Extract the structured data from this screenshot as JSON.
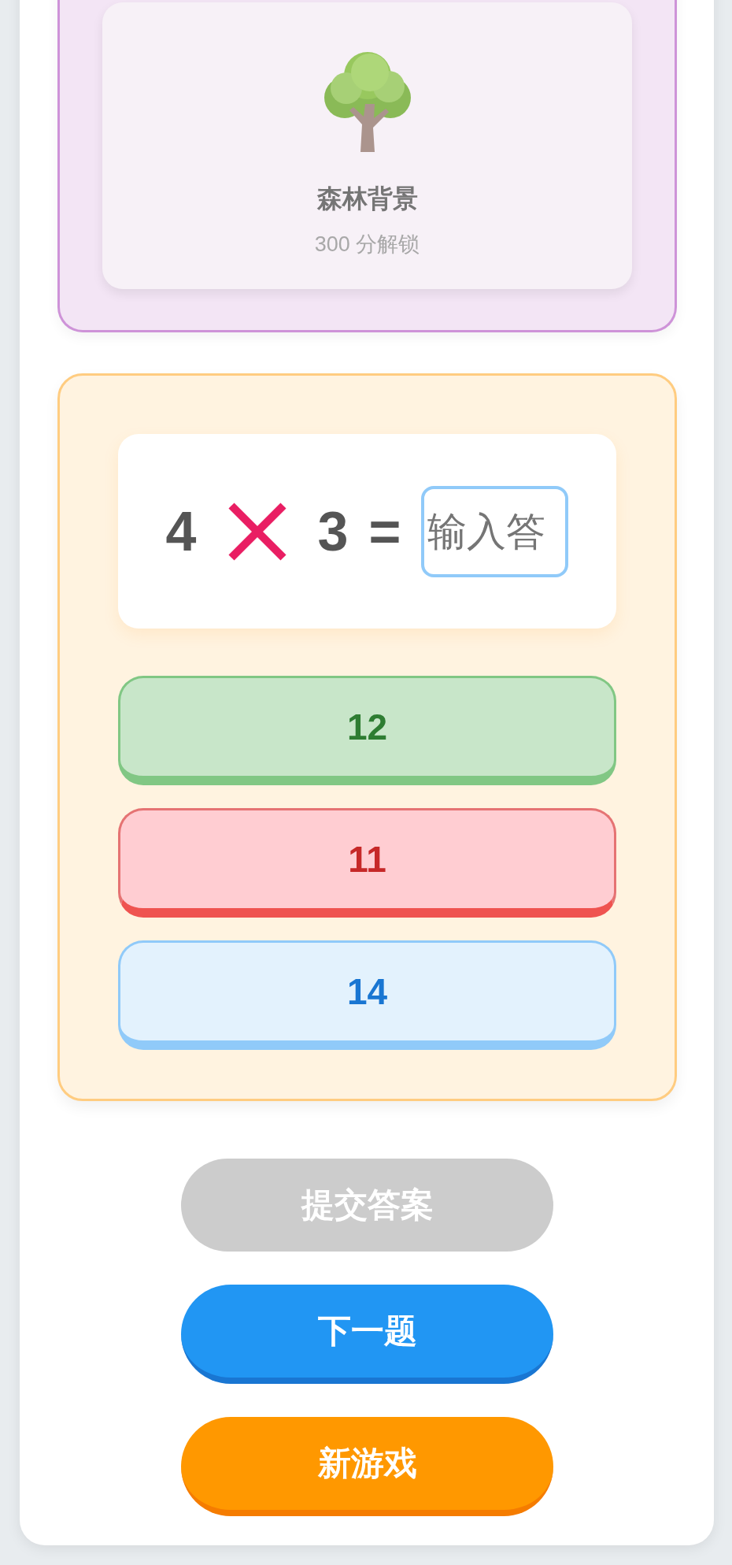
{
  "reward_shop": {
    "items": [
      {
        "name": "森林背景",
        "price": "300 分解锁",
        "locked": true
      }
    ]
  },
  "question": {
    "operand_1": "4",
    "operand_2": "3",
    "equals": "=",
    "answer": {
      "placeholder": "输入答"
    }
  },
  "options": [
    {
      "text": "12",
      "kind": "correct"
    },
    {
      "text": "11",
      "kind": "wrong"
    },
    {
      "text": "14",
      "kind": "plain"
    }
  ],
  "buttons": [
    {
      "label": "提交答案",
      "kind": "submit",
      "disabled": true
    },
    {
      "label": "下一题",
      "kind": "next",
      "disabled": false
    },
    {
      "label": "新游戏",
      "kind": "restart",
      "disabled": false
    }
  ]
}
